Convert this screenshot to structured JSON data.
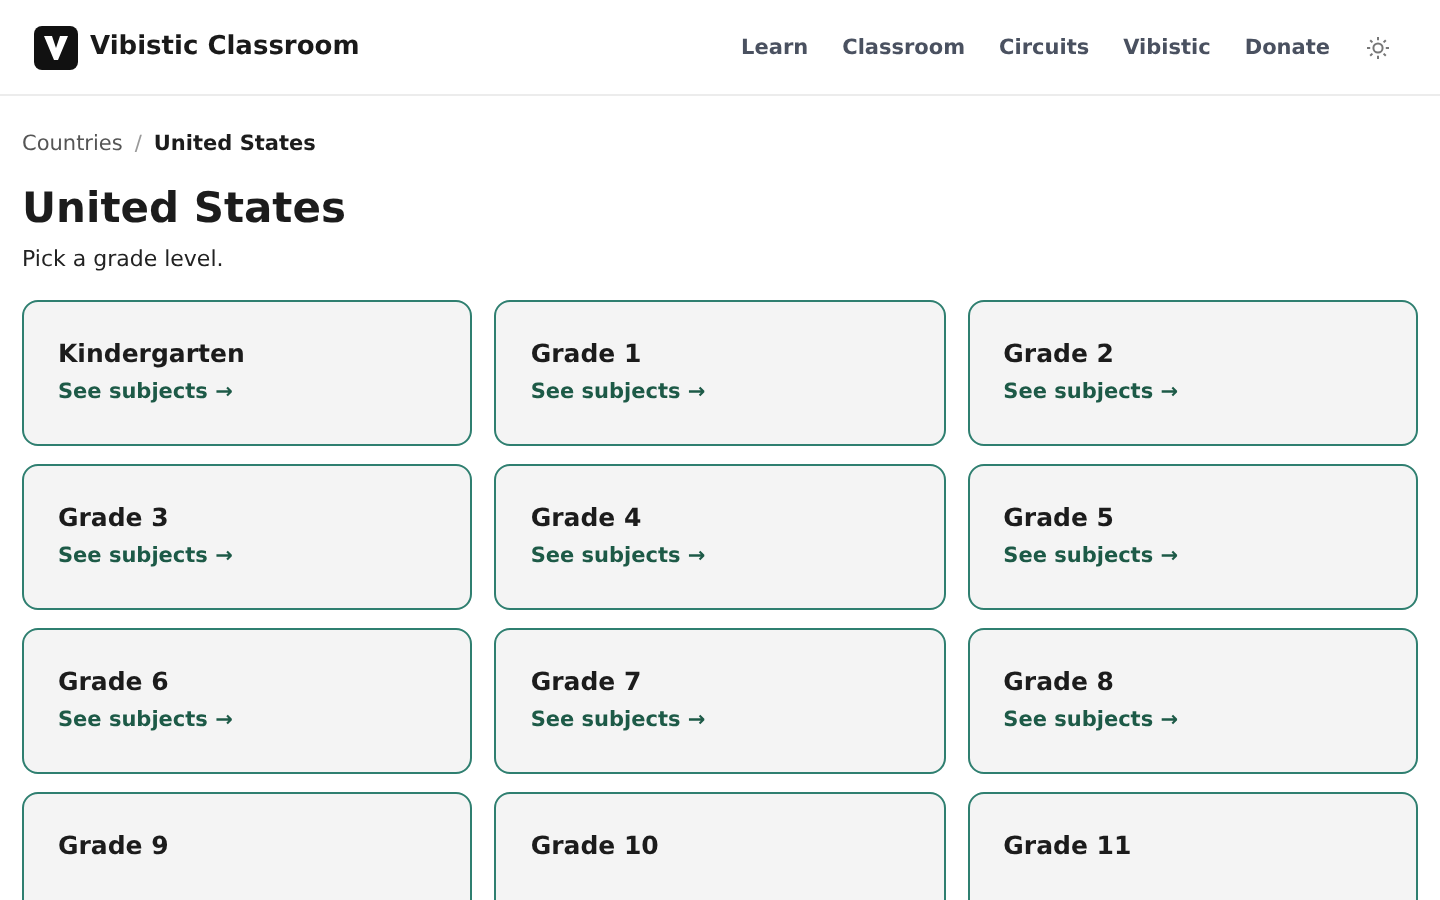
{
  "header": {
    "brand": "Vibistic Classroom",
    "nav": [
      {
        "label": "Learn"
      },
      {
        "label": "Classroom"
      },
      {
        "label": "Circuits"
      },
      {
        "label": "Vibistic"
      },
      {
        "label": "Donate"
      }
    ]
  },
  "breadcrumb_separator": "/",
  "breadcrumb": [
    {
      "label": "Countries",
      "current": false
    },
    {
      "label": "United States",
      "current": true
    }
  ],
  "title": "United States",
  "subtitle": "Pick a grade level.",
  "grades": [
    {
      "name": "Kindergarten",
      "link": "See subjects →"
    },
    {
      "name": "Grade 1",
      "link": "See subjects →"
    },
    {
      "name": "Grade 2",
      "link": "See subjects →"
    },
    {
      "name": "Grade 3",
      "link": "See subjects →"
    },
    {
      "name": "Grade 4",
      "link": "See subjects →"
    },
    {
      "name": "Grade 5",
      "link": "See subjects →"
    },
    {
      "name": "Grade 6",
      "link": "See subjects →"
    },
    {
      "name": "Grade 7",
      "link": "See subjects →"
    },
    {
      "name": "Grade 8",
      "link": "See subjects →"
    },
    {
      "name": "Grade 9"
    },
    {
      "name": "Grade 10"
    },
    {
      "name": "Grade 11"
    }
  ]
}
